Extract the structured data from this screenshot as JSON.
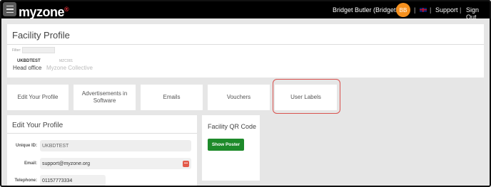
{
  "topbar": {
    "logo": "myzone",
    "user_name": "Bridget Butler (BridgetB)",
    "avatar_initials": "BB",
    "separator": "|",
    "support_label": "Support",
    "signout_label": "Sign Out",
    "flag_icon": "uk-flag-icon"
  },
  "facility_profile": {
    "title": "Facility Profile",
    "filter_label": "Filter:",
    "code_primary": "UKBDTEST",
    "code_secondary": "MZC001",
    "sub_primary": "Head office",
    "sub_secondary": "Myzone Collective"
  },
  "tabs": [
    {
      "label": "Edit Your Profile"
    },
    {
      "label": "Advertisements in Software"
    },
    {
      "label": "Emails"
    },
    {
      "label": "Vouchers"
    },
    {
      "label": "User Labels"
    }
  ],
  "edit_profile": {
    "title": "Edit Your Profile",
    "unique_id_label": "Unique ID:",
    "unique_id_value": "UKBDTEST",
    "email_label": "Email:",
    "email_value": "support@myzone.org",
    "telephone_label": "Telephone:",
    "telephone_value": "01157773334"
  },
  "qr": {
    "title": "Facility QR Code",
    "button_label": "Show Poster"
  },
  "colors": {
    "accent_orange": "#f5901e",
    "button_green": "#1d8a2a",
    "highlight_red": "#d9534f"
  }
}
